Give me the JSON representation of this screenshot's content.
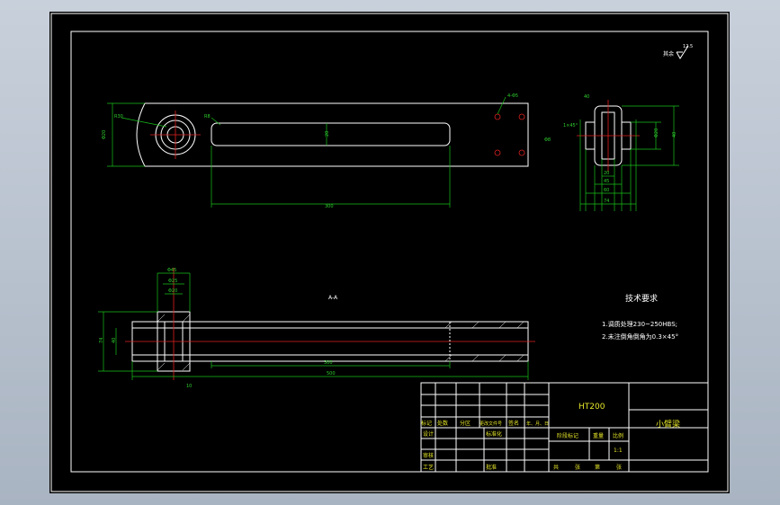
{
  "surface_symbol": "其余",
  "surface_roughness": "12.5",
  "top_view": {
    "dims": {
      "d_boss": "R30",
      "d_slot_angle": "R8",
      "d_hole_right": "4-Φ5",
      "d_height_left": "Φ20",
      "d_slot_width": "20",
      "d_slot_length": "300"
    }
  },
  "side_view": {
    "dims": {
      "left_small": "Φ8",
      "left_small2": "1×45°",
      "top_small": "40",
      "r1": "Φ20",
      "r2": "40",
      "b1": "20",
      "b2": "45",
      "b3": "60",
      "b4": "74"
    }
  },
  "front_section": {
    "dims": {
      "t1": "Φ45",
      "t2": "Φ25",
      "t3": "Φ20",
      "l1": "74",
      "l2": "40",
      "b1": "300",
      "b2": "500",
      "b3": "10"
    },
    "section_mark": "A-A"
  },
  "tech_req": {
    "title": "技术要求",
    "items": [
      "1.调质处理230~250HBS;",
      "2.未注倒角倒角为0.3×45°"
    ]
  },
  "title_block": {
    "material": "HT200",
    "part_name": "小臂梁",
    "scale": "1:1",
    "headers": [
      "标记",
      "处数",
      "分区",
      "更改文件号",
      "签名",
      "年、月、日"
    ],
    "row_design": [
      "设计",
      "标准化"
    ],
    "stage_headers": [
      "阶段标记",
      "重量",
      "比例"
    ],
    "row_review": "审核",
    "row_process": [
      "工艺",
      "批准"
    ],
    "sheet_info": [
      "共",
      "张",
      "第",
      "张"
    ]
  }
}
